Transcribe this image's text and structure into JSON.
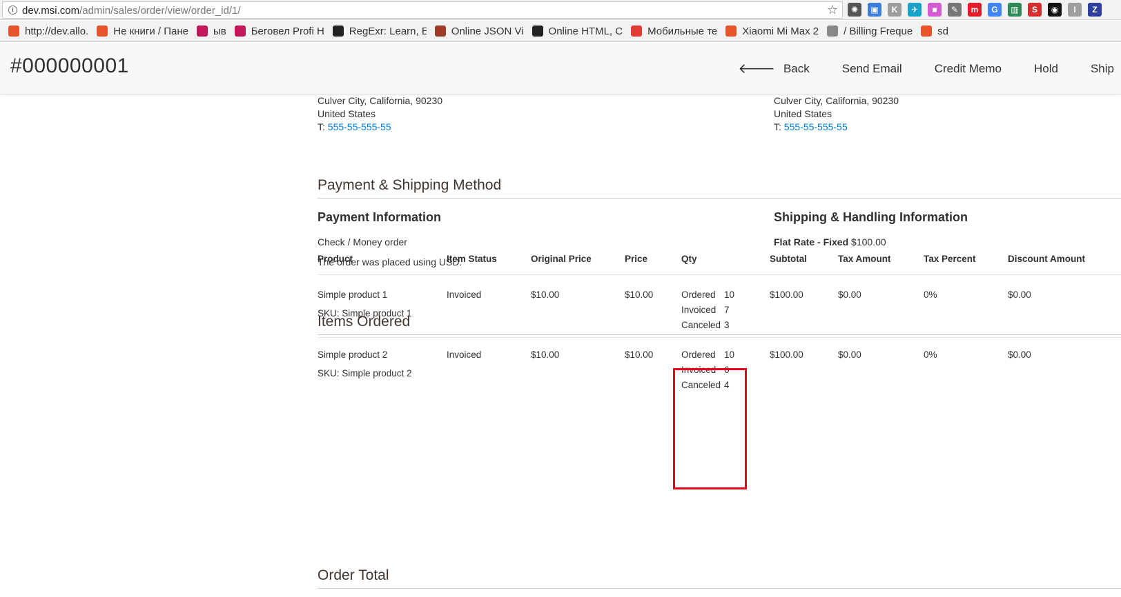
{
  "browser": {
    "url_host": "dev.msi.com",
    "url_path": "/admin/sales/order/view/order_id/1/",
    "bookmarks": [
      {
        "label": "http://dev.allo.",
        "color": "#e8542b"
      },
      {
        "label": "Не книги / Пане",
        "color": "#e8542b"
      },
      {
        "label": "ыв",
        "color": "#c2185b"
      },
      {
        "label": "Беговел Profi H",
        "color": "#c2185b"
      },
      {
        "label": "RegExr: Learn, E",
        "color": "#222222"
      },
      {
        "label": "Online JSON Vi",
        "color": "#9e3a2a"
      },
      {
        "label": "Online HTML, C",
        "color": "#222222"
      },
      {
        "label": "Мобильные те",
        "color": "#e53935"
      },
      {
        "label": "Xiaomi Mi Max 2",
        "color": "#e8542b"
      },
      {
        "label": "/ Billing Freque",
        "color": "#888888"
      },
      {
        "label": "sd",
        "color": "#e8542b"
      }
    ],
    "extensions": [
      {
        "name": "gear-extension-icon",
        "color": "#555555",
        "glyph": "✺"
      },
      {
        "name": "box-extension-icon",
        "color": "#3d7ed8",
        "glyph": "▣"
      },
      {
        "name": "k-extension-icon",
        "color": "#9e9e9e",
        "glyph": "K"
      },
      {
        "name": "bird-extension-icon",
        "color": "#1aa3c8",
        "glyph": "✈"
      },
      {
        "name": "gradient-extension-icon",
        "color": "#d35bd1",
        "glyph": "■"
      },
      {
        "name": "tag-extension-icon",
        "color": "#777777",
        "glyph": "✎"
      },
      {
        "name": "m-extension-icon",
        "color": "#e31b2b",
        "glyph": "m"
      },
      {
        "name": "translate-extension-icon",
        "color": "#4285f4",
        "glyph": "G"
      },
      {
        "name": "chart-extension-icon",
        "color": "#2e8b57",
        "glyph": "▥"
      },
      {
        "name": "seo-extension-icon",
        "color": "#d32f2f",
        "glyph": "S"
      },
      {
        "name": "eye-extension-icon",
        "color": "#111111",
        "glyph": "◉"
      },
      {
        "name": "i-extension-icon",
        "color": "#9e9e9e",
        "glyph": "I"
      },
      {
        "name": "z-extension-icon",
        "color": "#2f3f9e",
        "glyph": "Z"
      }
    ]
  },
  "header": {
    "title": "#000000001",
    "actions": [
      "Back",
      "Send Email",
      "Credit Memo",
      "Hold",
      "Ship"
    ]
  },
  "addresses": {
    "billing": {
      "city_line": "Culver City, California, 90230",
      "country": "United States",
      "phone_prefix": "T: ",
      "phone": "555-55-555-55"
    },
    "shipping": {
      "city_line": "Culver City, California, 90230",
      "country": "United States",
      "phone_prefix": "T: ",
      "phone": "555-55-555-55"
    }
  },
  "payment_shipping": {
    "section_title": "Payment & Shipping Method",
    "payment_title": "Payment Information",
    "payment_method": "Check / Money order",
    "currency_note": "The order was placed using USD.",
    "shipping_title": "Shipping & Handling Information",
    "shipping_method": "Flat Rate - Fixed",
    "shipping_price": "$100.00"
  },
  "items": {
    "section_title": "Items Ordered",
    "columns": [
      "Product",
      "Item Status",
      "Original Price",
      "Price",
      "Qty",
      "Subtotal",
      "Tax Amount",
      "Tax Percent",
      "Discount Amount"
    ],
    "rows": [
      {
        "product": "Simple product 1",
        "sku": "SKU: Simple product 1",
        "status": "Invoiced",
        "original_price": "$10.00",
        "price": "$10.00",
        "qty": [
          {
            "label": "Ordered",
            "value": "10"
          },
          {
            "label": "Invoiced",
            "value": "7"
          },
          {
            "label": "Canceled",
            "value": "3"
          }
        ],
        "subtotal": "$100.00",
        "tax_amount": "$0.00",
        "tax_percent": "0%",
        "discount": "$0.00"
      },
      {
        "product": "Simple product 2",
        "sku": "SKU: Simple product 2",
        "status": "Invoiced",
        "original_price": "$10.00",
        "price": "$10.00",
        "qty": [
          {
            "label": "Ordered",
            "value": "10"
          },
          {
            "label": "Invoiced",
            "value": "6"
          },
          {
            "label": "Canceled",
            "value": "4"
          }
        ],
        "subtotal": "$100.00",
        "tax_amount": "$0.00",
        "tax_percent": "0%",
        "discount": "$0.00"
      }
    ]
  },
  "totals": {
    "section_title": "Order Total"
  },
  "colors": {
    "link": "#007bdb",
    "highlight": "#e3001b"
  }
}
